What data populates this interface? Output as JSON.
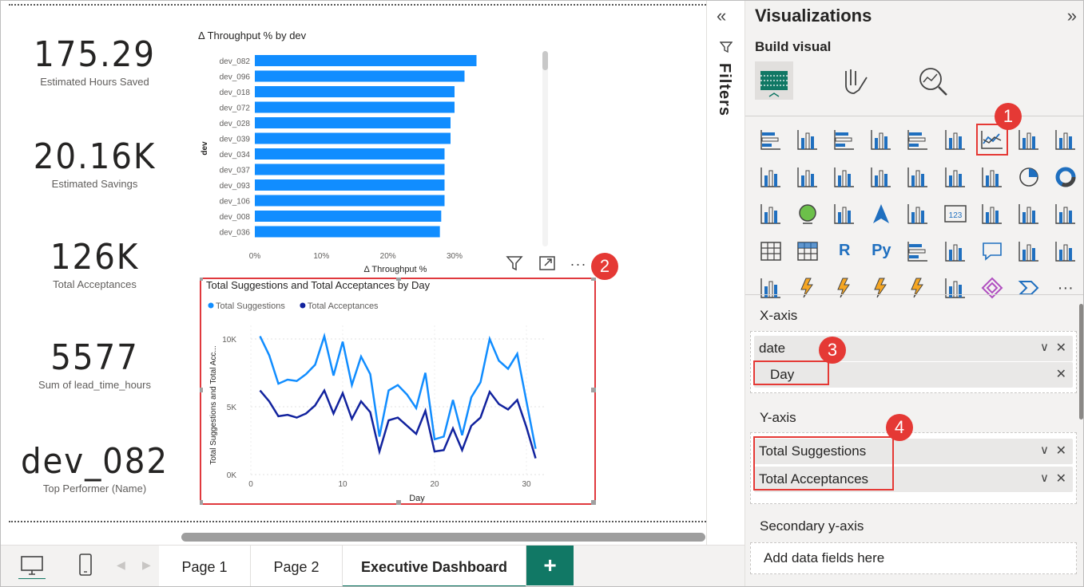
{
  "kpis": [
    {
      "value": "175.29",
      "label": "Estimated Hours Saved"
    },
    {
      "value": "20.16K",
      "label": "Estimated Savings"
    },
    {
      "value": "126K",
      "label": "Total Acceptances"
    },
    {
      "value": "5577",
      "label": "Sum of lead_time_hours"
    },
    {
      "value": "dev_082",
      "label": "Top Performer (Name)"
    }
  ],
  "chart_data": [
    {
      "type": "bar",
      "orientation": "horizontal",
      "title": "Δ Throughput % by dev",
      "xlabel": "Δ Throughput %",
      "ylabel": "dev",
      "categories": [
        "dev_082",
        "dev_096",
        "dev_018",
        "dev_072",
        "dev_028",
        "dev_039",
        "dev_034",
        "dev_037",
        "dev_093",
        "dev_106",
        "dev_008",
        "dev_036"
      ],
      "values": [
        33.3,
        31.5,
        30.0,
        30.0,
        29.4,
        29.4,
        28.5,
        28.5,
        28.5,
        28.5,
        28.0,
        27.8
      ],
      "xticks": [
        "0%",
        "10%",
        "20%",
        "30%"
      ],
      "xlim": [
        0,
        36
      ],
      "color": "#118dff"
    },
    {
      "type": "line",
      "title": "Total Suggestions and Total Acceptances by Day",
      "xlabel": "Day",
      "ylabel": "Total Suggestions and Total Acc...",
      "x": [
        1,
        2,
        3,
        4,
        5,
        6,
        7,
        8,
        9,
        10,
        11,
        12,
        13,
        14,
        15,
        16,
        17,
        18,
        19,
        20,
        21,
        22,
        23,
        24,
        25,
        26,
        27,
        28,
        29,
        30,
        31
      ],
      "xticks": [
        "0",
        "10",
        "20",
        "30"
      ],
      "yticks": [
        "0K",
        "5K",
        "10K"
      ],
      "ylim": [
        0,
        11000
      ],
      "legend_position": "top-left",
      "series": [
        {
          "name": "Total Suggestions",
          "color": "#118dff",
          "values": [
            10200,
            8800,
            6700,
            7000,
            6900,
            7400,
            8100,
            10200,
            7300,
            9800,
            6600,
            8700,
            7400,
            2800,
            6200,
            6600,
            5900,
            4900,
            7500,
            2600,
            2800,
            5500,
            2900,
            5700,
            6800,
            10000,
            8400,
            7800,
            8900,
            5400,
            1900
          ]
        },
        {
          "name": "Total Acceptances",
          "color": "#12239e",
          "values": [
            6200,
            5400,
            4300,
            4400,
            4200,
            4500,
            5100,
            6200,
            4500,
            6000,
            4100,
            5400,
            4600,
            1700,
            4000,
            4200,
            3600,
            3000,
            4700,
            1700,
            1800,
            3400,
            1800,
            3600,
            4200,
            6100,
            5200,
            4800,
            5500,
            3500,
            1200
          ]
        }
      ]
    }
  ],
  "chart_tools": {
    "filter": "filter-icon",
    "focus": "focus-mode-icon",
    "more": "···"
  },
  "badges": [
    "1",
    "2",
    "3",
    "4"
  ],
  "tabs": [
    "Page 1",
    "Page 2",
    "Executive Dashboard"
  ],
  "add_tab": "+",
  "filters_pane": {
    "label": "Filters"
  },
  "viz_pane": {
    "title": "Visualizations",
    "build_visual": "Build visual",
    "x_axis": {
      "label": "X-axis",
      "field": "date",
      "sub": "Day"
    },
    "y_axis": {
      "label": "Y-axis",
      "fields": [
        "Total Suggestions",
        "Total Acceptances"
      ]
    },
    "secondary_y": {
      "label": "Secondary y-axis",
      "placeholder": "Add data fields here"
    }
  },
  "colors": {
    "accent": "#117865",
    "bar": "#118dff",
    "line1": "#118dff",
    "line2": "#12239e",
    "badge": "#e53935"
  }
}
